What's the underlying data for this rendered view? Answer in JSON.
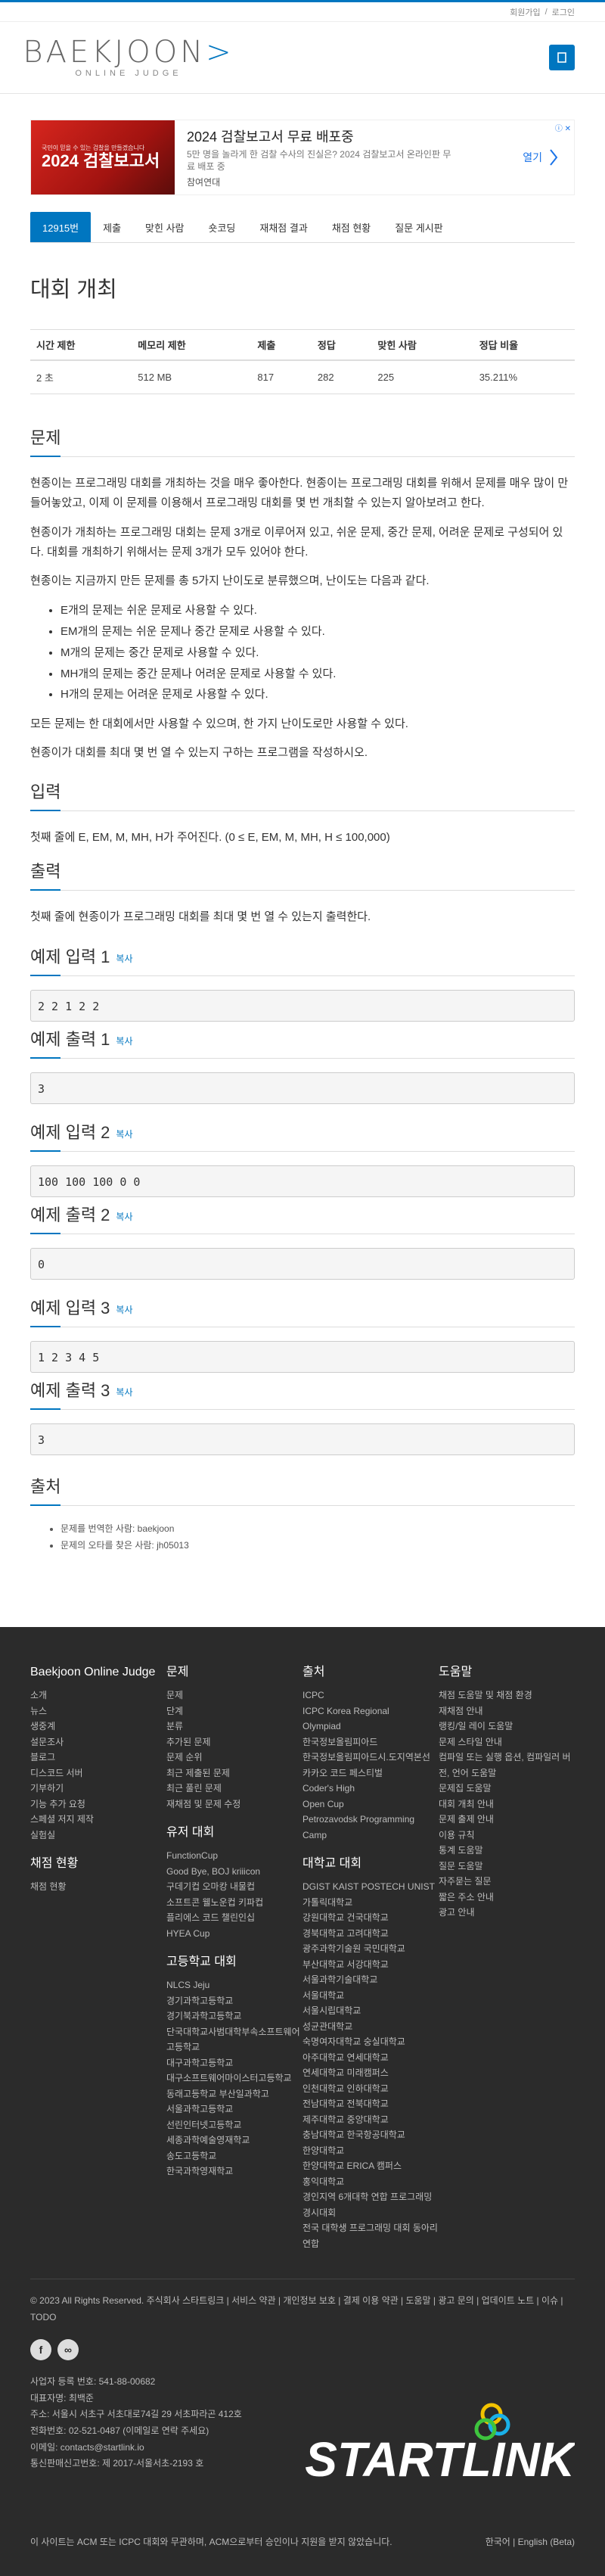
{
  "topbar": {
    "signup": "회원가입",
    "login": "로그인",
    "sep": "/"
  },
  "logo": {
    "main_a": "BAEKJOON",
    "main_b": ">",
    "sub": "ONLINE JUDGE"
  },
  "ad": {
    "image_small": "국민이 믿을 수 있는 검찰을 만들겠습니다",
    "image_big": "2024 검찰보고서",
    "title": "2024 검찰보고서 무료 배포중",
    "desc": "5만 명을 놀라게 한 검찰 수사의 진실은? 2024 검찰보고서 온라인판 무료 배포 중",
    "source": "참여연대",
    "open": "열기"
  },
  "tabs": [
    "12915번",
    "제출",
    "맞힌 사람",
    "숏코딩",
    "재채점 결과",
    "채점 현황",
    "질문 게시판"
  ],
  "problem": {
    "title": "대회 개최",
    "headers": [
      "시간 제한",
      "메모리 제한",
      "제출",
      "정답",
      "맞힌 사람",
      "정답 비율"
    ],
    "values": [
      "2 초",
      "512 MB",
      "817",
      "282",
      "225",
      "35.211%"
    ]
  },
  "sections": {
    "problem_h": "문제",
    "p1": "현종이는 프로그래밍 대회를 개최하는 것을 매우 좋아한다. 현종이는 프로그래밍 대회를 위해서 문제를 매우 많이 만들어놓았고, 이제 이 문제를 이용해서 프로그래밍 대회를 몇 번 개최할 수 있는지 알아보려고 한다.",
    "p2": "현종이가 개최하는 프로그래밍 대회는 문제 3개로 이루어져 있고, 쉬운 문제, 중간 문제, 어려운 문제로 구성되어 있다. 대회를 개최하기 위해서는 문제 3개가 모두 있어야 한다.",
    "p3": "현종이는 지금까지 만든 문제를 총 5가지 난이도로 분류했으며, 난이도는 다음과 같다.",
    "rules": [
      "E개의 문제는 쉬운 문제로 사용할 수 있다.",
      "EM개의 문제는 쉬운 문제나 중간 문제로 사용할 수 있다.",
      "M개의 문제는 중간 문제로 사용할 수 있다.",
      "MH개의 문제는 중간 문제나 어려운 문제로 사용할 수 있다.",
      "H개의 문제는 어려운 문제로 사용할 수 있다."
    ],
    "p4": "모든 문제는 한 대회에서만 사용할 수 있으며, 한 가지 난이도로만 사용할 수 있다.",
    "p5": "현종이가 대회를 최대 몇 번 열 수 있는지 구하는 프로그램을 작성하시오.",
    "input_h": "입력",
    "input_p": "첫째 줄에 E, EM, M, MH, H가 주어진다. (0 ≤ E, EM, M, MH, H ≤ 100,000)",
    "output_h": "출력",
    "output_p": "첫째 줄에 현종이가 프로그래밍 대회를 최대 몇 번 열 수 있는지 출력한다.",
    "copy": "복사",
    "samples": [
      {
        "in_h": "예제 입력 1",
        "in": "2 2 1 2 2",
        "out_h": "예제 출력 1",
        "out": "3"
      },
      {
        "in_h": "예제 입력 2",
        "in": "100 100 100 0 0",
        "out_h": "예제 출력 2",
        "out": "0"
      },
      {
        "in_h": "예제 입력 3",
        "in": "1 2 3 4 5",
        "out_h": "예제 출력 3",
        "out": "3"
      }
    ],
    "source_h": "출처",
    "credits": [
      "문제를 번역한 사람: baekjoon",
      "문제의 오타를 찾은 사람: jh05013"
    ]
  },
  "footer": {
    "col1": {
      "h": "Baekjoon Online Judge",
      "items": [
        "소개",
        "뉴스",
        "생중계",
        "설문조사",
        "블로그",
        "디스코드 서버",
        "기부하기",
        "기능 추가 요청",
        "스페셜 저지 제작",
        "실험실"
      ],
      "h2": "채점 현황",
      "items2": [
        "채점 현황"
      ]
    },
    "col2": {
      "h": "문제",
      "items": [
        "문제",
        "단계",
        "분류",
        "추가된 문제",
        "문제 순위",
        "최근 제출된 문제",
        "최근 풀린 문제",
        "재채점 및 문제 수정"
      ],
      "h2": "유저 대회",
      "items2": [
        "FunctionCup",
        "Good Bye, BOJ kriiicon",
        "구데기컵 오마캉 내물컵",
        "소프트콘 웰노운컵 키파컵",
        "플리에스 코드 챌린인십",
        "HYEA Cup"
      ],
      "h3": "고등학교 대회",
      "items3": [
        "NLCS Jeju",
        "경기과학고등학교",
        "경기북과학고등학교",
        "단국대학교사범대학부속소프트웨어고등학교",
        "대구과학고등학교",
        "대구소프트웨어마이스터고등학교",
        "동래고등학교 부산일과학고",
        "서울과학고등학교",
        "선린인터넷고등학교",
        "세종과학예술영재학교",
        "송도고등학교",
        "한국과학영재학교"
      ]
    },
    "col3": {
      "h": "출처",
      "items": [
        "ICPC",
        "ICPC Korea Regional",
        "Olympiad",
        "한국정보올림피아드",
        "한국정보올림피아드시.도지역본선",
        "카카오 코드 페스티벌",
        "Coder's High",
        "Open Cup",
        "Petrozavodsk Programming Camp"
      ],
      "h2": "대학교 대회",
      "items2": [
        "DGIST KAIST POSTECH UNIST 가톨릭대학교",
        "강원대학교 건국대학교",
        "경북대학교 고려대학교",
        "광주과학기술원 국민대학교",
        "부산대학교 서강대학교",
        "서울과학기술대학교",
        "서울대학교",
        "서울시립대학교",
        "성균관대학교",
        "숙명여자대학교 숭실대학교",
        "아주대학교 연세대학교",
        "연세대학교 미래캠퍼스",
        "인천대학교 인하대학교",
        "전남대학교 전북대학교",
        "제주대학교 중앙대학교",
        "충남대학교 한국항공대학교",
        "한양대학교",
        "한양대학교 ERICA 캠퍼스",
        "홍익대학교",
        "경인지역 6개대학 연합 프로그래밍 경시대회",
        "전국 대학생 프로그래밍 대회 동아리 연합"
      ]
    },
    "col4": {
      "h": "도움말",
      "items": [
        "채점 도움말 및 채점 환경",
        "재채점 안내",
        "랭킹/일 레이 도움말",
        "문제 스타일 안내",
        "컴파일 또는 실행 옵션, 컴파일러 버전, 언어 도움말",
        "문제집 도움말",
        "대회 개최 안내",
        "문제 출제 안내",
        "이용 규칙",
        "통계 도움말",
        "질문 도움말",
        "자주묻는 질문",
        "짧은 주소 안내",
        "광고 안내"
      ]
    },
    "copyright": "© 2023 All Rights Reserved. 주식회사 스타트링크 | 서비스 약관 | 개인정보 보호 | 결제 이용 약관 | 도움말 | 광고 문의 | 업데이트 노트 | 이슈 | TODO",
    "social": [
      "f",
      "∞"
    ],
    "biz": [
      "사업자 등록 번호: 541-88-00682",
      "대표자명: 최백준",
      "주소: 서울시 서초구 서초대로74길 29 서초파라곤 412호",
      "전화번호: 02-521-0487 (이메일로 연락 주세요)",
      "이메일: contacts@startlink.io",
      "통신판매신고번호: 제 2017-서울서초-2193 호"
    ],
    "brand": "STARTLINK",
    "disclaimer": "이 사이트는 ACM 또는 ICPC 대회와 무관하며, ACM으로부터 승인이나 지원을 받지 않았습니다.",
    "lang": "한국어 | English (Beta)"
  }
}
